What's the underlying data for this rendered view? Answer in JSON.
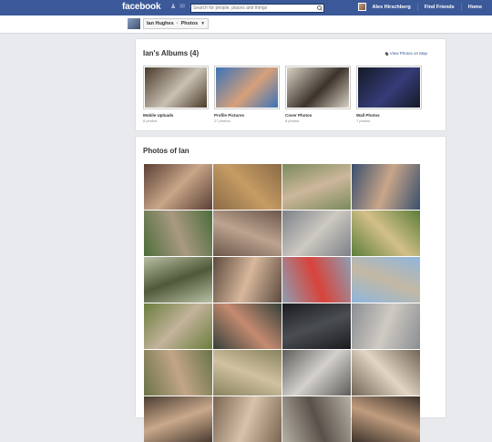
{
  "topbar": {
    "logo": "facebook",
    "search_placeholder": "Search for people, places and things",
    "user_name": "Alex Hirschberg",
    "find_friends": "Find Friends",
    "home": "Home"
  },
  "breadcrumb": {
    "name": "Ian Hughes",
    "section": "Photos"
  },
  "albums_section": {
    "title": "Ian's Albums (4)",
    "map_link": "View Photos on Map",
    "albums": [
      {
        "name": "Mobile Uploads",
        "count": "8 photos",
        "colors": [
          "#4a3a2a",
          "#c9c1b3"
        ]
      },
      {
        "name": "Profile Pictures",
        "count": "27 photos",
        "colors": [
          "#3a73b8",
          "#d6a07a"
        ]
      },
      {
        "name": "Cover Photos",
        "count": "8 photos",
        "colors": [
          "#d9d2c3",
          "#3d332c"
        ]
      },
      {
        "name": "Wall Photos",
        "count": "7 photos",
        "colors": [
          "#141a26",
          "#353c78"
        ]
      }
    ]
  },
  "photos_section": {
    "title": "Photos of Ian",
    "photos": [
      [
        "#5a3f34",
        "#c8a688"
      ],
      [
        "#8a6a46",
        "#c79c64"
      ],
      [
        "#7a8a5c",
        "#cdb79b"
      ],
      [
        "#3a4f6e",
        "#c9a689"
      ],
      [
        "#4d6d3b",
        "#a99981"
      ],
      [
        "#6b574b",
        "#bca38f"
      ],
      [
        "#7c8087",
        "#cdc9c2"
      ],
      [
        "#5c7e3a",
        "#d3c089"
      ],
      [
        "#b7bfa2",
        "#4f5a3a"
      ],
      [
        "#5d4a3e",
        "#d7b89c"
      ],
      [
        "#8d9fb2",
        "#d8433b"
      ],
      [
        "#8fb6dd",
        "#c4b8a4"
      ],
      [
        "#6a7d3c",
        "#c3b39b"
      ],
      [
        "#34403a",
        "#c58b70"
      ],
      [
        "#1a1c1f",
        "#4a4d52"
      ],
      [
        "#8a8e92",
        "#cfcac3"
      ],
      [
        "#6b7449",
        "#c2a586"
      ],
      [
        "#88835e",
        "#d1c1a1"
      ],
      [
        "#5d5d5a",
        "#d4d1cc"
      ],
      [
        "#726556",
        "#e1d5c3"
      ],
      [
        "#4a3c30",
        "#c9a98c"
      ],
      [
        "#7a6552",
        "#d7c3aa"
      ],
      [
        "#b6b0a3",
        "#5a514a"
      ],
      [
        "#3d332b",
        "#c09c7e"
      ]
    ]
  }
}
